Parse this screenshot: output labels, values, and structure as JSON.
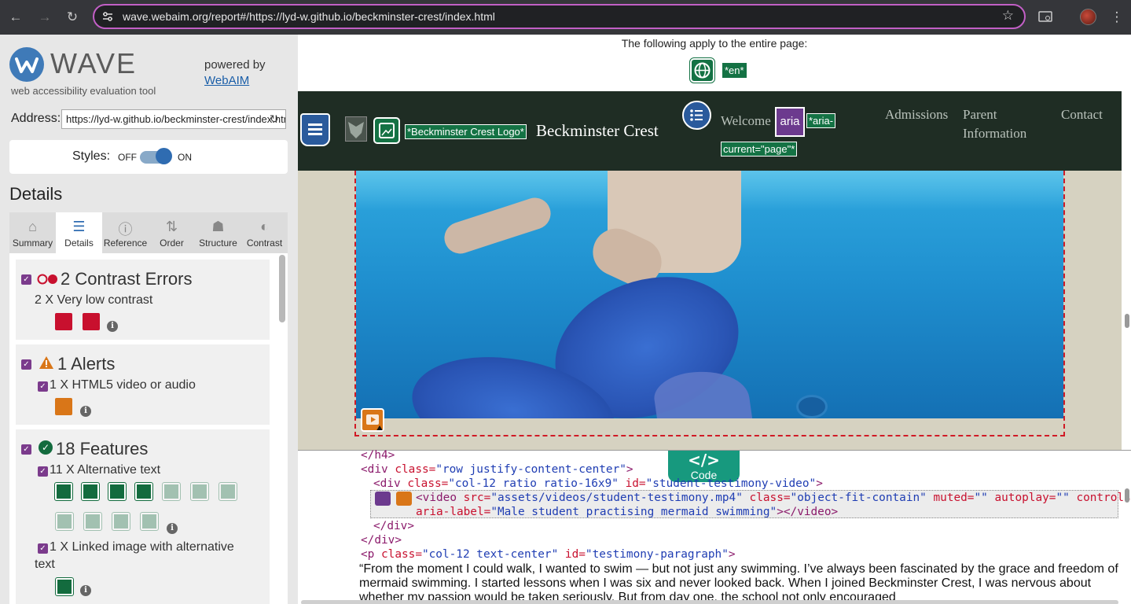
{
  "browser": {
    "url": "wave.webaim.org/report#/https://lyd-w.github.io/beckminster-crest/index.html",
    "icons": [
      "back-icon",
      "forward-icon",
      "reload-icon",
      "site-settings-icon",
      "bookmark-star-icon",
      "cast-icon",
      "profile-avatar",
      "menu-icon"
    ]
  },
  "wave": {
    "title": "WAVE",
    "subtitle": "web accessibility evaluation tool",
    "powered_by": "powered by",
    "webaim": "WebAIM",
    "address_label": "Address:",
    "address_value": "https://lyd-w.github.io/beckminster-crest/index.html",
    "styles_label": "Styles:",
    "styles_off": "OFF",
    "styles_on": "ON",
    "details_heading": "Details",
    "tabs": [
      {
        "label": "Summary",
        "icon": "home-icon"
      },
      {
        "label": "Details",
        "icon": "list-icon"
      },
      {
        "label": "Reference",
        "icon": "info-icon"
      },
      {
        "label": "Order",
        "icon": "order-icon"
      },
      {
        "label": "Structure",
        "icon": "structure-icon"
      },
      {
        "label": "Contrast",
        "icon": "contrast-icon"
      }
    ],
    "active_tab": "Details",
    "contrast": {
      "title": "2 Contrast Errors",
      "item": "2 X Very low contrast"
    },
    "alerts": {
      "title": "1 Alerts",
      "item": "1 X HTML5 video or audio"
    },
    "features": {
      "title": "18 Features",
      "item1": "11 X Alternative text",
      "item2_line1": "1 X Linked image with alternative",
      "item2_line2": "text"
    }
  },
  "page": {
    "apply_text": "The following apply to the entire page:",
    "lang_tag": "*en*",
    "logo_tag": "*Beckminster Crest Logo*",
    "brand": "Beckminster Crest",
    "welcome": "Welcome",
    "aria_badge": "aria",
    "aria_tag_line1": "*aria-",
    "aria_tag_line2": "current=\"page\"*",
    "nav": {
      "admissions": "Admissions",
      "parent_line1": "Parent",
      "parent_line2": "Information",
      "contact": "Contact"
    }
  },
  "code": {
    "button_label": "Code",
    "button_icon": "</>",
    "line1": "</h4>",
    "line2_open": "<div ",
    "line2_attr": "class=",
    "line2_val": "\"row justify-content-center\"",
    "line2_close": ">",
    "line3_open": "<div ",
    "line3_attr1": "class=",
    "line3_val1": "\"col-12 ratio ratio-16x9\"",
    "line3_attr2": " id=",
    "line3_val2": "\"student-testimony-video\"",
    "line3_close": ">",
    "line4_open": "<video ",
    "line4_a1": "src=",
    "line4_v1": "\"assets/videos/student-testimony.mp4\"",
    "line4_a2": " class=",
    "line4_v2": "\"object-fit-contain\"",
    "line4_a3": " muted=",
    "line4_v3": "\"\"",
    "line4_a4": " autoplay=",
    "line4_v4": "\"\"",
    "line4_a5": " controls=",
    "line4_v5": "\"\"",
    "line5_a1": "aria-label=",
    "line5_v1": "\"Male student practising mermaid swimming\"",
    "line5_close": "></video>",
    "line6": "</div>",
    "line7": "</div>",
    "line8_open": "<p ",
    "line8_a1": "class=",
    "line8_v1": "\"col-12 text-center\"",
    "line8_a2": " id=",
    "line8_v2": "\"testimony-paragraph\"",
    "line8_close": ">",
    "paragraph": "“From the moment I could walk, I wanted to swim — but not just any swimming. I’ve always been fascinated by the grace and freedom of mermaid swimming. I started lessons when I was six and never looked back. When I joined Beckminster Crest, I was nervous about whether my passion would be taken seriously. But from day one, the school not only encouraged"
  }
}
